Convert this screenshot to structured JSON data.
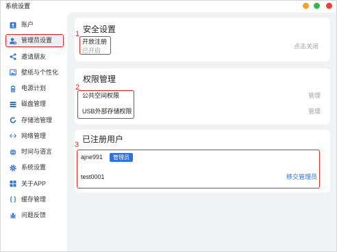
{
  "window": {
    "title": "系统设置"
  },
  "colors": {
    "accent": "#2f72d8",
    "annotation": "#e3261e",
    "control-orange": "#f2a12e",
    "control-green": "#3db44a",
    "control-red": "#e64236",
    "page-bg": "#f1f2f4",
    "card-bg": "#ffffff",
    "text": "#222222",
    "muted": "#a3a3a3",
    "selected-bg": "#eceff4"
  },
  "sidebar": {
    "items": [
      {
        "label": "账户",
        "icon": "account-icon",
        "selected": false
      },
      {
        "label": "管理员设置",
        "icon": "admin-settings-icon",
        "selected": true
      },
      {
        "label": "邀请朋友",
        "icon": "share-icon",
        "selected": false
      },
      {
        "label": "壁纸与个性化",
        "icon": "wallpaper-icon",
        "selected": false
      },
      {
        "label": "电源计划",
        "icon": "battery-icon",
        "selected": false
      },
      {
        "label": "磁盘管理",
        "icon": "disk-icon",
        "selected": false
      },
      {
        "label": "存储池管理",
        "icon": "storage-pool-icon",
        "selected": false
      },
      {
        "label": "网络管理",
        "icon": "network-icon",
        "selected": false
      },
      {
        "label": "时间与语言",
        "icon": "globe-icon",
        "selected": false
      },
      {
        "label": "系统设置",
        "icon": "gear-icon",
        "selected": false
      },
      {
        "label": "关于APP",
        "icon": "app-grid-icon",
        "selected": false
      },
      {
        "label": "缓存管理",
        "icon": "braces-icon",
        "selected": false
      },
      {
        "label": "问题反馈",
        "icon": "bug-icon",
        "selected": false
      }
    ]
  },
  "security": {
    "title": "安全设置",
    "marker": "1",
    "registration": {
      "label": "开放注册",
      "status": "已开启",
      "action": "点击关闭"
    }
  },
  "permissions": {
    "title": "权限管理",
    "marker": "2",
    "rows": [
      {
        "label": "公共空间权限",
        "action": "管理"
      },
      {
        "label": "USB外部存储权限",
        "action": "管理"
      }
    ]
  },
  "users": {
    "title": "已注册用户",
    "marker": "3",
    "rows": [
      {
        "name": "ajne991",
        "badge": "管理员"
      },
      {
        "name": "test0001",
        "action": "移交管理员"
      }
    ]
  }
}
